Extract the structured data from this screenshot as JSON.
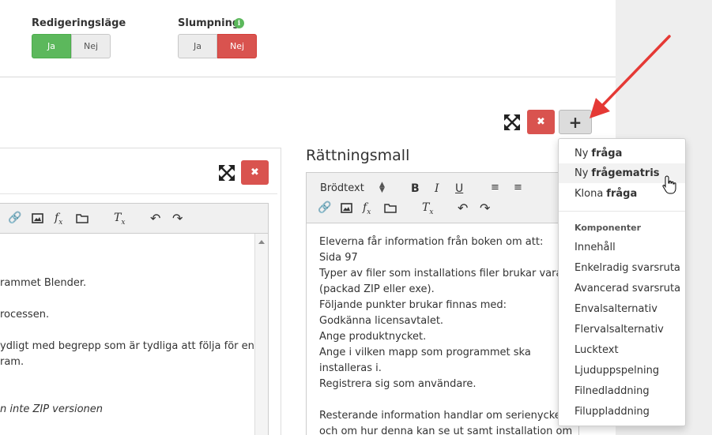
{
  "settings": {
    "editing_mode": {
      "label": "Redigeringsläge",
      "yes": "Ja",
      "no": "Nej",
      "selected": "Ja"
    },
    "randomize": {
      "label": "Slumpning",
      "info_glyph": "i",
      "yes": "Ja",
      "no": "Nej",
      "selected": "Nej"
    }
  },
  "buttons": {
    "close_glyph": "✖",
    "add_glyph": "+"
  },
  "left_editor": {
    "lines": [
      "rammet Blender.",
      "rocessen.",
      "ydligt med begrepp som är tydliga att följa för en",
      "ram.",
      "n inte ZIP versionen"
    ]
  },
  "right_panel": {
    "title": "Rättningsmall",
    "format_label": "Brödtext",
    "content": [
      "Eleverna får information från boken om att:",
      "Sida 97",
      "Typer av filer som installations filer brukar vara.",
      "(packad ZIP eller exe).",
      "Följande punkter brukar finnas med:",
      "Godkänna licensavtalet.",
      "Ange produktnycket.",
      "Ange i vilken mapp som programmet ska",
      "installeras i.",
      "Registrera sig som användare.",
      "",
      "Resterande information handlar om serienyckeln",
      "och om hur denna kan se ut samt installation om"
    ]
  },
  "dropdown": {
    "new_question_prefix": "Ny",
    "new_question_bold": "fråga",
    "new_matrix_prefix": "Ny",
    "new_matrix_bold": "frågematris",
    "clone_prefix": "Klona",
    "clone_bold": "fråga",
    "components_header": "Komponenter",
    "components": [
      "Innehåll",
      "Enkelradig svarsruta",
      "Avancerad svarsruta",
      "Envalsalternativ",
      "Flervalsalternativ",
      "Lucktext",
      "Ljuduppspelning",
      "Filnedladdning",
      "Filuppladdning"
    ]
  },
  "colors": {
    "green": "#5cb85c",
    "red": "#d9534f",
    "annotation_arrow": "#e53935"
  }
}
